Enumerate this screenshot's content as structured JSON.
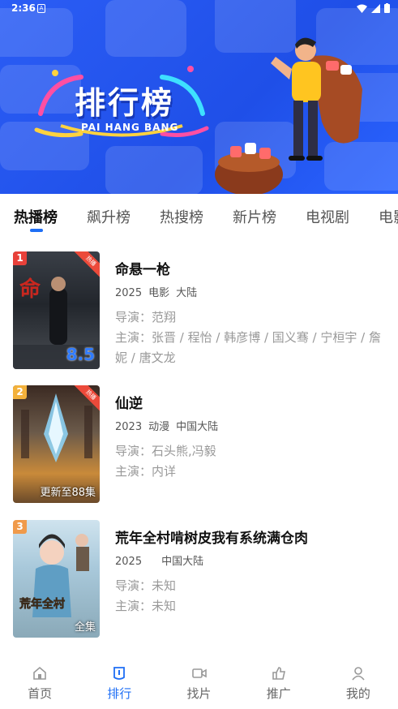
{
  "status": {
    "time": "2:36",
    "notification_letter": "A"
  },
  "banner": {
    "title": "排行榜",
    "subtitle": "PAI HANG BANG"
  },
  "tabs": [
    {
      "label": "热播榜",
      "active": true
    },
    {
      "label": "飙升榜"
    },
    {
      "label": "热搜榜"
    },
    {
      "label": "新片榜"
    },
    {
      "label": "电视剧"
    },
    {
      "label": "电影"
    }
  ],
  "items": [
    {
      "rank": "1",
      "ribbon": "热播",
      "poster_score": "8.5",
      "title": "命悬一枪",
      "year": "2025",
      "type": "电影",
      "region": "大陆",
      "director_label": "导演：",
      "director": "范翔",
      "cast_label": "主演：",
      "cast": "张晋 / 程怡 / 韩彦博 / 国义骞 / 宁桓宇 / 詹妮 / 唐文龙",
      "rank_color": "#e8413a"
    },
    {
      "rank": "2",
      "ribbon": "热播",
      "poster_label": "更新至88集",
      "title": "仙逆",
      "year": "2023",
      "type": "动漫",
      "region": "中国大陆",
      "director_label": "导演：",
      "director": "石头熊,冯毅",
      "cast_label": "主演：",
      "cast": "内详",
      "rank_color": "#f3b13b"
    },
    {
      "rank": "3",
      "poster_label": "全集",
      "title": "荒年全村啃树皮我有系统满仓肉",
      "year": "2025",
      "type": "",
      "region": "中国大陆",
      "director_label": "导演：",
      "director": "未知",
      "cast_label": "主演：",
      "cast": "未知",
      "rank_color": "#f09a4a"
    }
  ],
  "nav": [
    {
      "label": "首页",
      "icon": "home-icon"
    },
    {
      "label": "排行",
      "icon": "rank-icon",
      "active": true
    },
    {
      "label": "找片",
      "icon": "video-icon"
    },
    {
      "label": "推广",
      "icon": "thumb-icon"
    },
    {
      "label": "我的",
      "icon": "user-icon"
    }
  ],
  "colors": {
    "accent": "#1e6ef5",
    "banner": "#2b5df5"
  }
}
